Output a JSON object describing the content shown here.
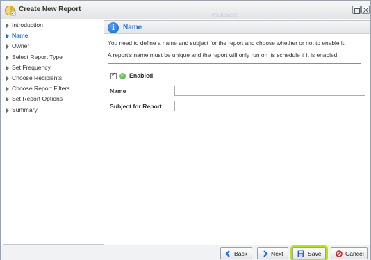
{
  "window": {
    "title": "Create New Report",
    "ghost_text": "Vault2ware"
  },
  "sidebar": {
    "steps": [
      {
        "label": "Introduction",
        "active": false
      },
      {
        "label": "Name",
        "active": true
      },
      {
        "label": "Owner",
        "active": false
      },
      {
        "label": "Select Report Type",
        "active": false
      },
      {
        "label": "Set Frequency",
        "active": false
      },
      {
        "label": "Choose Recipients",
        "active": false
      },
      {
        "label": "Choose Report Filters",
        "active": false
      },
      {
        "label": "Set Report Options",
        "active": false
      },
      {
        "label": "Summary",
        "active": false
      }
    ]
  },
  "main": {
    "heading": "Name",
    "description_1": "You need to define a name and subject for the report and choose whether or not to enable it.",
    "description_2": "A report's name must be unique and the report will only run on its schedule if it is enabled.",
    "enabled_label": "Enabled",
    "enabled_checked": true,
    "name_label": "Name",
    "name_value": "",
    "subject_label": "Subject for Report",
    "subject_value": ""
  },
  "footer": {
    "back_label": "Back",
    "next_label": "Next",
    "save_label": "Save",
    "cancel_label": "Cancel"
  },
  "colors": {
    "accent": "#1e6fc7",
    "save_highlight": "#b6e21a",
    "enabled_status": "#3aa32b",
    "cancel_icon": "#d11f1f"
  }
}
